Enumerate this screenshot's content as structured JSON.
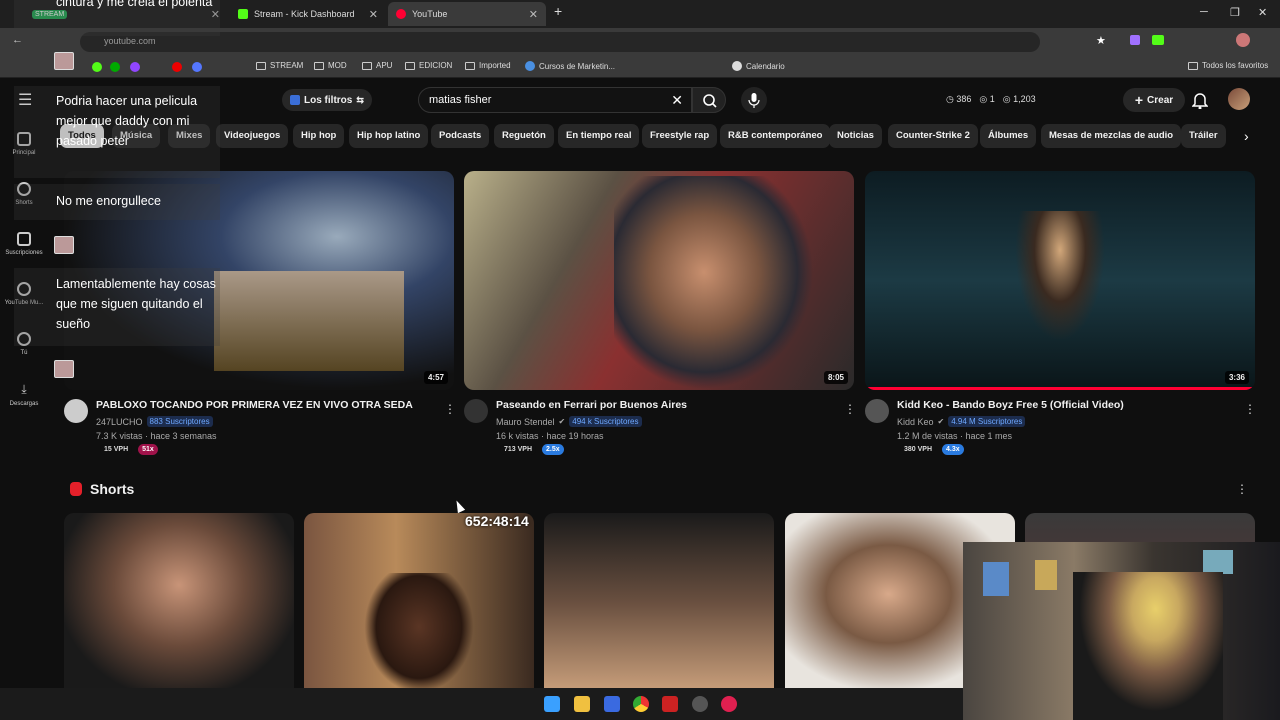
{
  "browser": {
    "tabs": [
      {
        "label": "Stream - Kick Dashboard",
        "color": "#53fc18"
      },
      {
        "label": "YouTube",
        "color": "#ff0033"
      }
    ],
    "stream_badge": "STREAM",
    "url": "youtube.com",
    "bookmarks": [
      "STREAM",
      "MOD",
      "APU",
      "EDICION",
      "Imported",
      "Cursos de Marketin...",
      "Calendario"
    ],
    "bookmarks_right": "Todos los favoritos"
  },
  "youtube": {
    "filter_label": "Los filtros",
    "search_value": "matias fisher",
    "stats": [
      "386",
      "1",
      "1,203"
    ],
    "create_label": "Crear",
    "chips": [
      "Todos",
      "Música",
      "Mixes",
      "Videojuegos",
      "Hip hop",
      "Hip hop latino",
      "Podcasts",
      "Reguetón",
      "En tiempo real",
      "Freestyle rap",
      "R&B contemporáneo",
      "Noticias",
      "Counter-Strike 2",
      "Álbumes",
      "Mesas de mezclas de audio",
      "Tráiler"
    ],
    "sidenav": [
      "Principal",
      "Shorts",
      "Suscripciones",
      "YouTube Mu...",
      "Tú",
      "Descargas"
    ],
    "videos": [
      {
        "title": "PABLOXO TOCANDO POR PRIMERA VEZ EN VIVO OTRA SEDA",
        "channel": "247LUCHO",
        "subs": "883 Suscriptores",
        "meta": "7.3 K vistas · hace 3 semanas",
        "vph": "15 VPH",
        "mult": "51x",
        "duration": "4:57"
      },
      {
        "title": "Paseando en Ferrari por Buenos Aires",
        "channel": "Mauro Stendel",
        "subs": "494 k Suscriptores",
        "meta": "16 k vistas · hace 19 horas",
        "vph": "713 VPH",
        "mult": "2.5x",
        "duration": "8:05"
      },
      {
        "title": "Kidd Keo - Bando Boyz Free 5  (Official Video)",
        "channel": "Kidd Keo",
        "subs": "4.94 M Suscriptores",
        "meta": "1.2 M de vistas · hace 1 mes",
        "vph": "380 VPH",
        "mult": "4.3x",
        "duration": "3:36"
      }
    ],
    "shorts_label": "Shorts",
    "timer": "652:48:14"
  },
  "chat": {
    "messages": [
      "cintura y me creia el polenta",
      "Podria hacer una pelicula mejor que daddy con mi pasado peter",
      "No me enorgullece",
      "Lamentablemente hay cosas que me siguen quitando el sueño"
    ]
  }
}
